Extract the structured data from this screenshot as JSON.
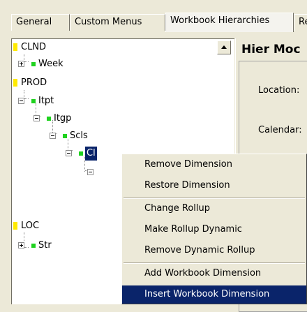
{
  "tabs": [
    "General",
    "Custom Menus",
    "Workbook Hierarchies",
    "Rea"
  ],
  "tree": {
    "clnd": "CLND",
    "week": "Week",
    "prod": "PROD",
    "itpt": "Itpt",
    "itgp": "Itgp",
    "scls": "Scls",
    "selected": "Cl",
    "loc": "LOC",
    "str": "Str"
  },
  "panel": {
    "title": "Hier Moc",
    "location_label": "Location:",
    "calendar_label": "Calendar:"
  },
  "context_menu": {
    "items": [
      "Remove Dimension",
      "Restore Dimension",
      "Change Rollup",
      "Make Rollup Dynamic",
      "Remove Dynamic Rollup",
      "Add Workbook Dimension",
      "Insert Workbook Dimension"
    ],
    "highlighted": "Insert Workbook Dimension"
  }
}
